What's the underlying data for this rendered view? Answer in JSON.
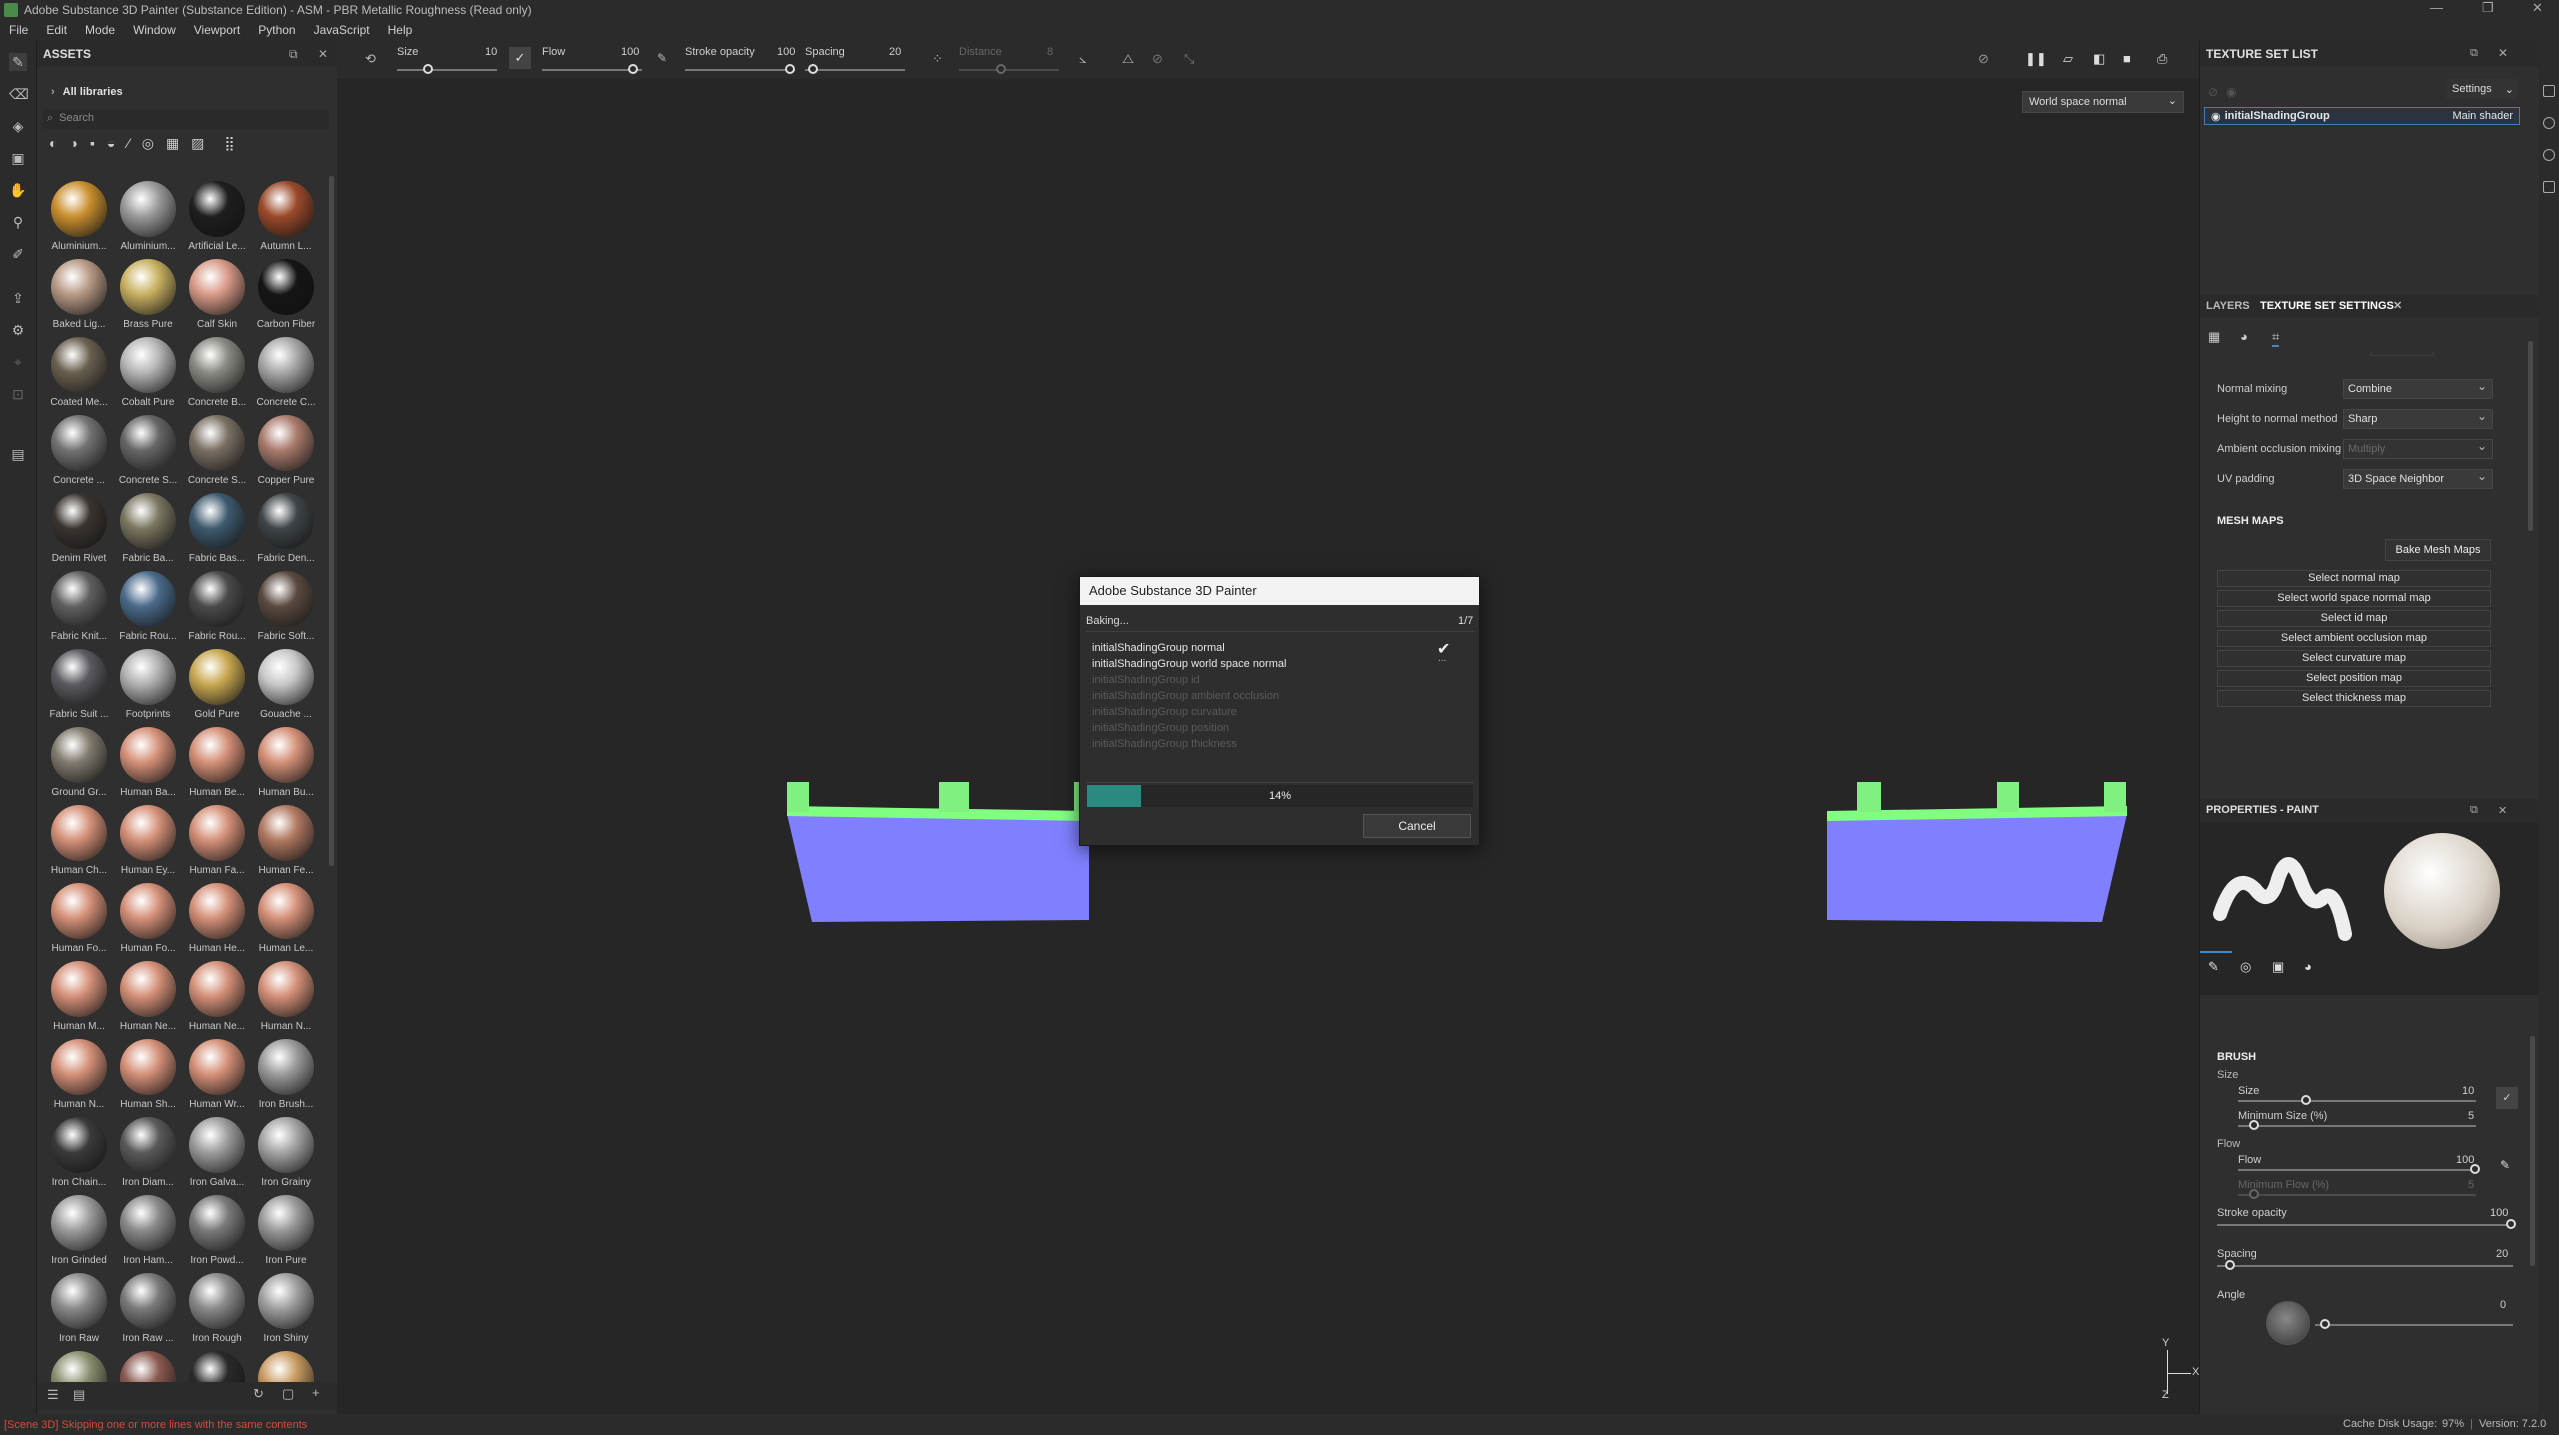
{
  "window": {
    "title": "Adobe Substance 3D Painter (Substance Edition) - ASM - PBR Metallic Roughness (Read only)"
  },
  "menu": [
    "File",
    "Edit",
    "Mode",
    "Window",
    "Viewport",
    "Python",
    "JavaScript",
    "Help"
  ],
  "assets": {
    "title": "ASSETS",
    "library": "All libraries",
    "search_placeholder": "Search",
    "items": [
      {
        "label": "Aluminium...",
        "color": "#c98f2e"
      },
      {
        "label": "Aluminium...",
        "color": "#9a9a9a"
      },
      {
        "label": "Artificial Le...",
        "color": "#1e1e1e"
      },
      {
        "label": "Autumn L...",
        "color": "#9b4a2a"
      },
      {
        "label": "Baked Lig...",
        "color": "#b89a86"
      },
      {
        "label": "Brass Pure",
        "color": "#c8b060"
      },
      {
        "label": "Calf Skin",
        "color": "#d89a88"
      },
      {
        "label": "Carbon Fiber",
        "color": "#151515"
      },
      {
        "label": "Coated Me...",
        "color": "#6a6050"
      },
      {
        "label": "Cobalt Pure",
        "color": "#b6b6b6"
      },
      {
        "label": "Concrete B...",
        "color": "#8a8a84"
      },
      {
        "label": "Concrete C...",
        "color": "#a8a8a8"
      },
      {
        "label": "Concrete ...",
        "color": "#727272"
      },
      {
        "label": "Concrete S...",
        "color": "#666"
      },
      {
        "label": "Concrete S...",
        "color": "#7a7064"
      },
      {
        "label": "Copper Pure",
        "color": "#a87a6c"
      },
      {
        "label": "Denim Rivet",
        "color": "#3a3430"
      },
      {
        "label": "Fabric Ba...",
        "color": "#7a7660"
      },
      {
        "label": "Fabric Bas...",
        "color": "#3e5a6e"
      },
      {
        "label": "Fabric Den...",
        "color": "#3e4448"
      },
      {
        "label": "Fabric Knit...",
        "color": "#606060"
      },
      {
        "label": "Fabric Rou...",
        "color": "#4a6a8a"
      },
      {
        "label": "Fabric Rou...",
        "color": "#4a4a4a"
      },
      {
        "label": "Fabric Soft...",
        "color": "#5a4a40"
      },
      {
        "label": "Fabric Suit ...",
        "color": "#5a5a60"
      },
      {
        "label": "Footprints",
        "color": "#b0b0b0"
      },
      {
        "label": "Gold Pure",
        "color": "#c8a850"
      },
      {
        "label": "Gouache ...",
        "color": "#c8c8c8"
      },
      {
        "label": "Ground Gr...",
        "color": "#807a6e"
      },
      {
        "label": "Human Ba...",
        "color": "#d49078"
      },
      {
        "label": "Human Be...",
        "color": "#d49078"
      },
      {
        "label": "Human Bu...",
        "color": "#d49078"
      },
      {
        "label": "Human Ch...",
        "color": "#d49078"
      },
      {
        "label": "Human Ey...",
        "color": "#d49078"
      },
      {
        "label": "Human Fa...",
        "color": "#d49078"
      },
      {
        "label": "Human Fe...",
        "color": "#b07860"
      },
      {
        "label": "Human Fo...",
        "color": "#d49078"
      },
      {
        "label": "Human Fo...",
        "color": "#d49078"
      },
      {
        "label": "Human He...",
        "color": "#d49078"
      },
      {
        "label": "Human Le...",
        "color": "#d49078"
      },
      {
        "label": "Human M...",
        "color": "#d49078"
      },
      {
        "label": "Human Ne...",
        "color": "#d49078"
      },
      {
        "label": "Human Ne...",
        "color": "#d49078"
      },
      {
        "label": "Human N...",
        "color": "#d49078"
      },
      {
        "label": "Human N...",
        "color": "#d49078"
      },
      {
        "label": "Human Sh...",
        "color": "#d49078"
      },
      {
        "label": "Human Wr...",
        "color": "#d49078"
      },
      {
        "label": "Iron Brush...",
        "color": "#9a9a9a"
      },
      {
        "label": "Iron Chain...",
        "color": "#3a3a3a"
      },
      {
        "label": "Iron Diam...",
        "color": "#5a5a5a"
      },
      {
        "label": "Iron Galva...",
        "color": "#9c9c9c"
      },
      {
        "label": "Iron Grainy",
        "color": "#a4a4a4"
      },
      {
        "label": "Iron Grinded",
        "color": "#9c9c9c"
      },
      {
        "label": "Iron Ham...",
        "color": "#8a8a8a"
      },
      {
        "label": "Iron Powd...",
        "color": "#7a7a7a"
      },
      {
        "label": "Iron Pure",
        "color": "#9a9a9a"
      },
      {
        "label": "Iron Raw",
        "color": "#8a8a8a"
      },
      {
        "label": "Iron Raw ...",
        "color": "#7a7a7a"
      },
      {
        "label": "Iron Rough",
        "color": "#8a8a8a"
      },
      {
        "label": "Iron Shiny",
        "color": "#a0a0a0"
      },
      {
        "label": "",
        "color": "#8a9070"
      },
      {
        "label": "",
        "color": "#8a5a50"
      },
      {
        "label": "",
        "color": "#2a2a2a"
      },
      {
        "label": "",
        "color": "#c89a60"
      }
    ]
  },
  "toolbar": {
    "size_label": "Size",
    "size_value": "10",
    "flow_label": "Flow",
    "flow_value": "100",
    "stroke_label": "Stroke opacity",
    "stroke_value": "100",
    "spacing_label": "Spacing",
    "spacing_value": "20",
    "distance_label": "Distance",
    "distance_value": "8"
  },
  "viewport": {
    "mode_select": "World space normal",
    "mesh_colors": {
      "body": "#8080ff",
      "top": "#80ff80"
    },
    "gizmo": {
      "x": "X",
      "y": "Y",
      "z": "Z"
    }
  },
  "texture_set_list": {
    "title": "TEXTURE SET LIST",
    "settings_label": "Settings",
    "row_name": "initialShadingGroup",
    "row_shader": "Main shader"
  },
  "tss": {
    "tab_layers": "LAYERS",
    "tab_tss": "TEXTURE SET SETTINGS",
    "rows": [
      {
        "label": "Normal mixing",
        "value": "Combine"
      },
      {
        "label": "Height to normal method",
        "value": "Sharp"
      },
      {
        "label": "Ambient occlusion mixing",
        "value": "Multiply"
      },
      {
        "label": "UV padding",
        "value": "3D Space Neighbor"
      }
    ],
    "mesh_maps_title": "MESH MAPS",
    "bake_button": "Bake Mesh Maps",
    "select_buttons": [
      "Select normal map",
      "Select world space normal map",
      "Select id map",
      "Select ambient occlusion map",
      "Select curvature map",
      "Select position map",
      "Select thickness map"
    ]
  },
  "properties": {
    "title": "PROPERTIES - PAINT",
    "brush_title": "BRUSH",
    "size_group": "Size",
    "size_label": "Size",
    "size_value": "10",
    "min_size_label": "Minimum Size (%)",
    "min_size_value": "5",
    "flow_group": "Flow",
    "flow_label": "Flow",
    "flow_value": "100",
    "min_flow_label": "Minimum Flow (%)",
    "min_flow_value": "5",
    "stroke_label": "Stroke opacity",
    "stroke_value": "100",
    "spacing_label": "Spacing",
    "spacing_value": "20",
    "angle_label": "Angle",
    "angle_value": "0"
  },
  "dialog": {
    "title": "Adobe Substance 3D Painter",
    "status": "Baking...",
    "counter": "1/7",
    "items": [
      {
        "label": "initialShadingGroup normal",
        "state": "done"
      },
      {
        "label": "initialShadingGroup world space normal",
        "state": "active"
      },
      {
        "label": "initialShadingGroup id",
        "state": "pending"
      },
      {
        "label": "initialShadingGroup ambient occlusion",
        "state": "pending"
      },
      {
        "label": "initialShadingGroup curvature",
        "state": "pending"
      },
      {
        "label": "initialShadingGroup position",
        "state": "pending"
      },
      {
        "label": "initialShadingGroup thickness",
        "state": "pending"
      }
    ],
    "active_mark": "...",
    "progress_percent": "14%",
    "progress_fraction": 0.14,
    "cancel_label": "Cancel"
  },
  "status": {
    "message": "[Scene 3D] Skipping one or more lines with the same contents",
    "cache_label": "Cache Disk Usage:",
    "cache_value": "97%",
    "version": "Version: 7.2.0"
  }
}
